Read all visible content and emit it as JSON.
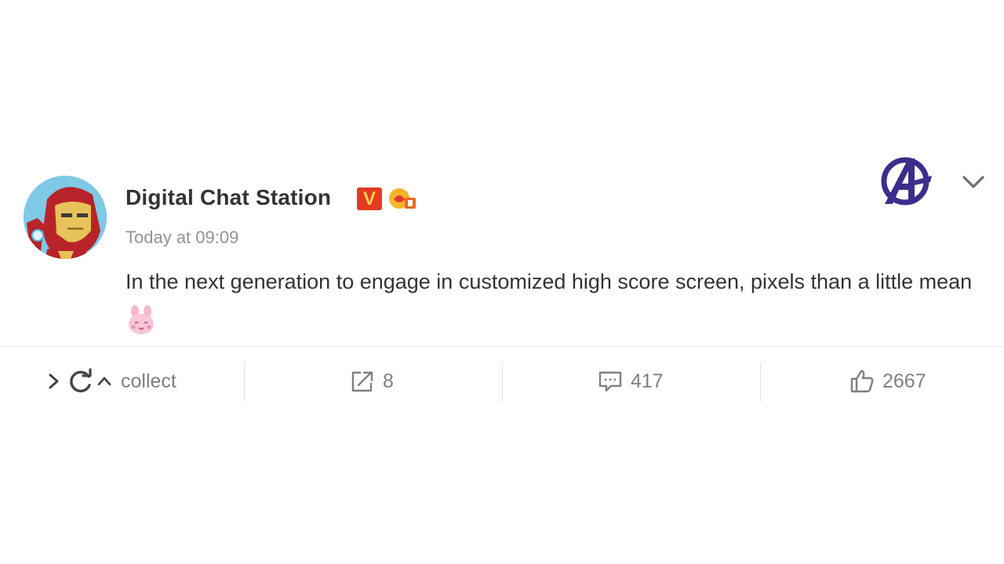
{
  "post": {
    "author_name": "Digital Chat Station",
    "verified_badge": "V",
    "timestamp": "Today at 09:09",
    "text": "In the next generation to engage in customized high score screen, pixels than a little mean",
    "avatar_icon": "iron-man-avatar",
    "emoji_icon": "bunny-emoji",
    "decoration_icon": "avengers-logo",
    "menu_icon": "chevron-down-icon"
  },
  "actions": {
    "collect_label": "collect",
    "repost_count": "8",
    "comment_count": "417",
    "like_count": "2667"
  },
  "colors": {
    "text_primary": "#333333",
    "text_muted": "#939393",
    "action_gray": "#808080",
    "verified_red": "#e33b1f",
    "verified_gold": "#ffd34e",
    "avengers_purple": "#3c2d8c"
  }
}
